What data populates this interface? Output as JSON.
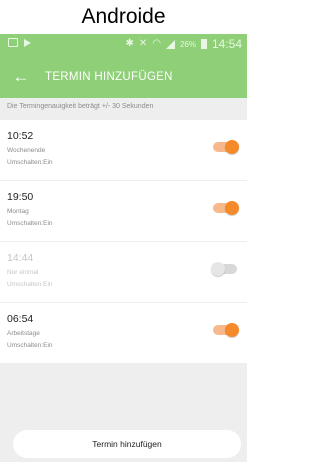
{
  "caption": "Androide",
  "status_bar": {
    "battery_percent": "26%",
    "time": "14:54"
  },
  "app_bar": {
    "title": "TERMIN HINZUFÜGEN"
  },
  "note": "Die Termingenauigkeit beträgt +/- 30 Sekunden",
  "schedules": [
    {
      "time": "10:52",
      "days": "Wochenende",
      "toggle_text": "Umschalten:Ein",
      "enabled": true
    },
    {
      "time": "19:50",
      "days": "Montag",
      "toggle_text": "Umschalten:Ein",
      "enabled": true
    },
    {
      "time": "14:44",
      "days": "Nur einmal",
      "toggle_text": "Umschalten:Ein",
      "enabled": false
    },
    {
      "time": "06:54",
      "days": "Arbeitstage",
      "toggle_text": "Umschalten:Ein",
      "enabled": true
    }
  ],
  "add_button_label": "Termin hinzufügen",
  "colors": {
    "app_bar": "#8fcf78",
    "switch_on": "#f48a2a",
    "background": "#eeeeee"
  }
}
